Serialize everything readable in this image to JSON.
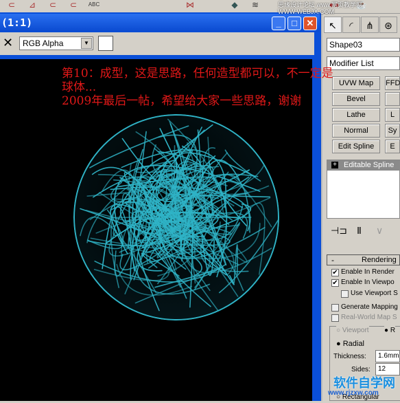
{
  "window": {
    "title": "(1:1)",
    "minimize": "_",
    "maximize": "□",
    "close": "✕"
  },
  "toolbar": {
    "close_icon": "✕",
    "channel": "RGB Alpha",
    "channel_arrow": "▼"
  },
  "annotation": {
    "line1": "第10：成型，这是思路，任何造型都可以，不一定是",
    "line2": "球体...",
    "line3": "2009年最后一帖，希望给大家一些思路，谢谢"
  },
  "colors": {
    "wire": "#2fb3c6",
    "annotation": "#e01818",
    "titlebar": "#0a4ad0"
  },
  "panel": {
    "object_name": "Shape03",
    "modifier_list": "Modifier List",
    "buttons": [
      [
        "UVW Map",
        "FFD"
      ],
      [
        "Bevel",
        ""
      ],
      [
        "Lathe",
        "L"
      ],
      [
        "Normal",
        "Sy"
      ],
      [
        "Edit Spline",
        "E"
      ]
    ],
    "stack_item": "Editable Spline",
    "stack_plus": "+",
    "rendering": {
      "header": "Rendering",
      "collapse": "-",
      "enable_render": "Enable In Render",
      "enable_viewport": "Enable In Viewpo",
      "use_viewport": "Use Viewport S",
      "gen_mapping": "Generate Mapping",
      "real_world": "Real-World Map S",
      "viewport_radio": "Viewport",
      "renderer_radio": "R",
      "radial": "Radial",
      "thickness_label": "Thickness:",
      "thickness": "1.6mm",
      "sides_label": "Sides:",
      "sides": "12",
      "rectangular": "Rectangular",
      "checked": {
        "enable_render": true,
        "enable_viewport": true,
        "use_viewport": false,
        "gen_mapping": false,
        "real_world": false
      }
    }
  },
  "watermarks": {
    "top": "思缘设计论坛 www.网页教学网 WWW.WEBJX.COM",
    "bottom": "软件自学网",
    "bottom_url": "www.rjzxw.com"
  }
}
